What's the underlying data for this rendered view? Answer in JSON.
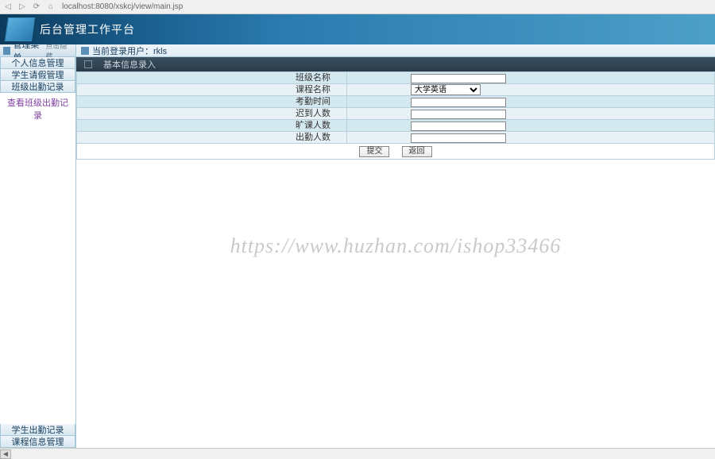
{
  "browser": {
    "url": "localhost:8080/xskcj/view/main.jsp"
  },
  "header": {
    "title": "后台管理工作平台"
  },
  "sidebar": {
    "menu_title": "管理菜单",
    "menu_hint": "点击隐藏",
    "items": [
      "个人信息管理",
      "学生请假管理",
      "班级出勤记录"
    ],
    "active_link": "查看班级出勤记录",
    "bottom_items": [
      "学生出勤记录",
      "课程信息管理"
    ]
  },
  "status": {
    "user_label": "当前登录用户：rkls"
  },
  "section": {
    "title": "基本信息录入"
  },
  "form": {
    "rows": [
      {
        "label": "班级名称",
        "type": "text",
        "value": ""
      },
      {
        "label": "课程名称",
        "type": "select",
        "value": "大学英语"
      },
      {
        "label": "考勤时间",
        "type": "text",
        "value": ""
      },
      {
        "label": "迟到人数",
        "type": "text",
        "value": ""
      },
      {
        "label": "旷课人数",
        "type": "text",
        "value": ""
      },
      {
        "label": "出勤人数",
        "type": "text",
        "value": ""
      }
    ],
    "select_options": [
      "大学英语"
    ],
    "submit_label": "提交",
    "back_label": "返回"
  },
  "watermark": "https://www.huzhan.com/ishop33466"
}
